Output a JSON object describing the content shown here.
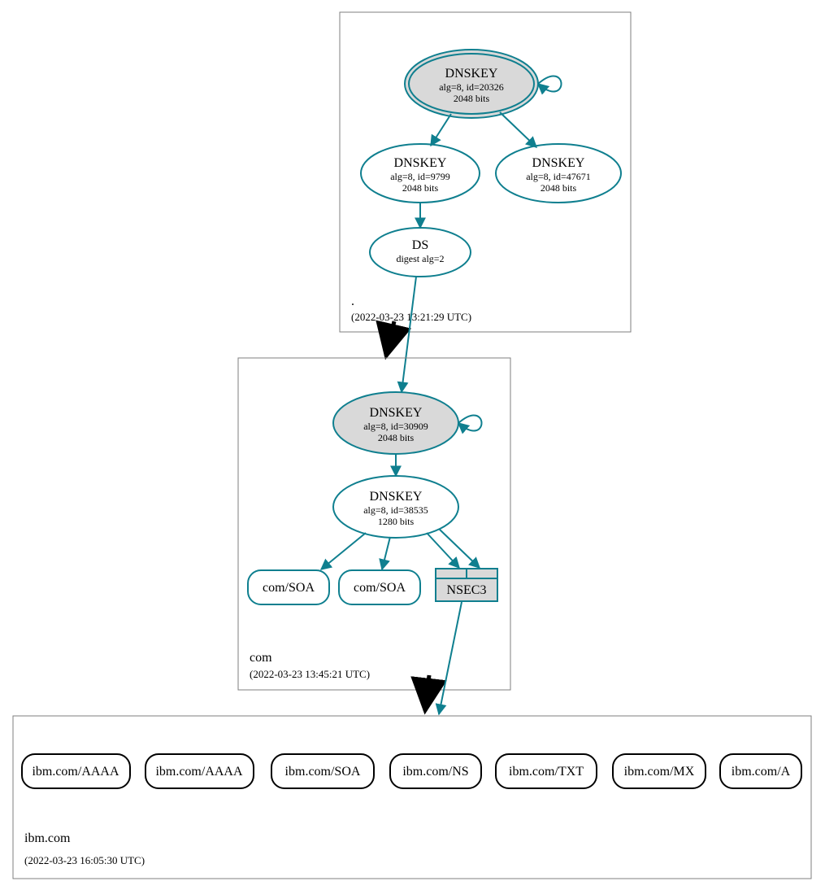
{
  "colors": {
    "teal": "#0f7f8f",
    "lightgray": "#d9d9d9",
    "black": "#000000"
  },
  "zones": {
    "root": {
      "label": ".",
      "timestamp": "(2022-03-23 13:21:29 UTC)"
    },
    "com": {
      "label": "com",
      "timestamp": "(2022-03-23 13:45:21 UTC)"
    },
    "ibm": {
      "label": "ibm.com",
      "timestamp": "(2022-03-23 16:05:30 UTC)"
    }
  },
  "nodes": {
    "root_ksk": {
      "title": "DNSKEY",
      "line1": "alg=8, id=20326",
      "line2": "2048 bits"
    },
    "root_zsk1": {
      "title": "DNSKEY",
      "line1": "alg=8, id=9799",
      "line2": "2048 bits"
    },
    "root_zsk2": {
      "title": "DNSKEY",
      "line1": "alg=8, id=47671",
      "line2": "2048 bits"
    },
    "root_ds": {
      "title": "DS",
      "line1": "digest alg=2"
    },
    "com_ksk": {
      "title": "DNSKEY",
      "line1": "alg=8, id=30909",
      "line2": "2048 bits"
    },
    "com_zsk": {
      "title": "DNSKEY",
      "line1": "alg=8, id=38535",
      "line2": "1280 bits"
    },
    "com_soa1": {
      "title": "com/SOA"
    },
    "com_soa2": {
      "title": "com/SOA"
    },
    "com_nsec3": {
      "title": "NSEC3"
    },
    "ibm_aaaa1": {
      "title": "ibm.com/AAAA"
    },
    "ibm_aaaa2": {
      "title": "ibm.com/AAAA"
    },
    "ibm_soa": {
      "title": "ibm.com/SOA"
    },
    "ibm_ns": {
      "title": "ibm.com/NS"
    },
    "ibm_txt": {
      "title": "ibm.com/TXT"
    },
    "ibm_mx": {
      "title": "ibm.com/MX"
    },
    "ibm_a": {
      "title": "ibm.com/A"
    }
  }
}
